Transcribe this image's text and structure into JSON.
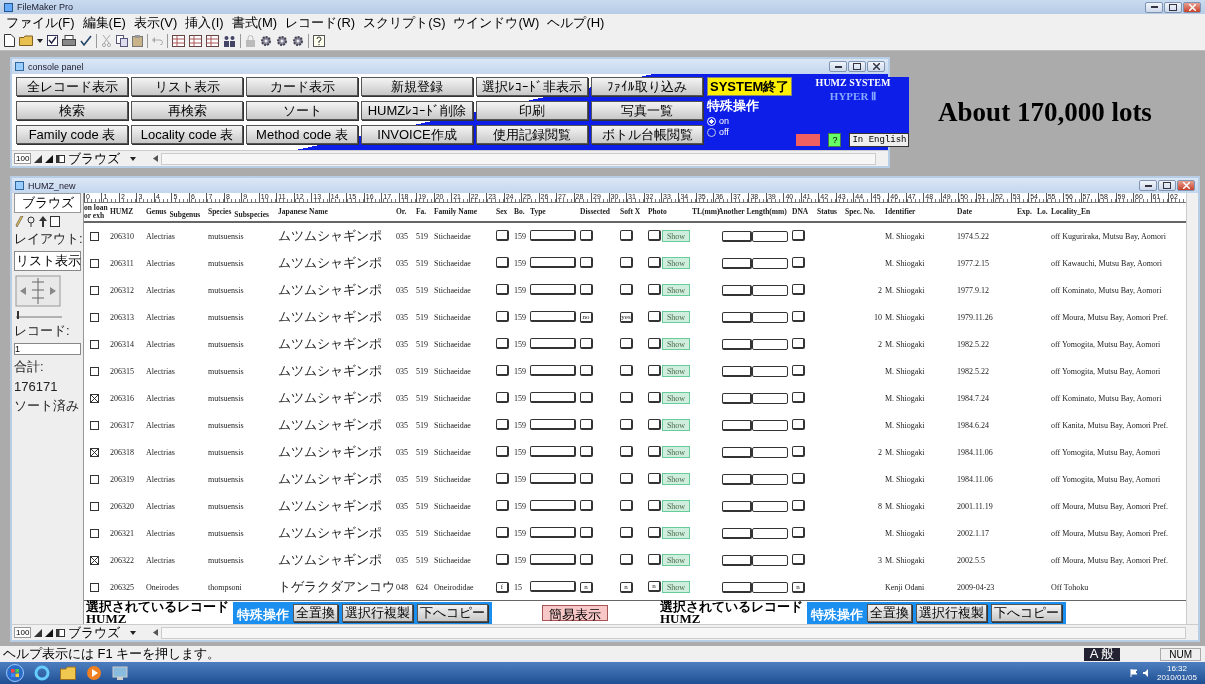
{
  "app": {
    "title": "FileMaker Pro"
  },
  "menu": [
    "ファイル(F)",
    "編集(E)",
    "表示(V)",
    "挿入(I)",
    "書式(M)",
    "レコード(R)",
    "スクリプト(S)",
    "ウインドウ(W)",
    "ヘルプ(H)"
  ],
  "console_panel": {
    "title": "console panel",
    "buttons": [
      "全レコード表示",
      "リスト表示",
      "カード表示",
      "新規登録",
      "選択ﾚｺｰﾄﾞ非表示",
      "ﾌｧｲﾙ取り込み",
      "検索",
      "再検索",
      "ソート",
      "HUMZﾚｺｰﾄﾞ削除",
      "印刷",
      "写真一覧",
      "Family code 表",
      "Locality code 表",
      "Method code 表",
      "INVOICE作成",
      "使用記録閲覧",
      "ボトル台帳閲覧"
    ],
    "system_exit": "SYSTEM終了",
    "special_label": "特殊操作",
    "radios": [
      {
        "label": "on",
        "selected": true
      },
      {
        "label": "off",
        "selected": false
      }
    ],
    "system_name": "HUMZ SYSTEM",
    "system_sub": "HYPER Ⅱ",
    "help_button": "?",
    "english_button": "In English",
    "zoom": "100",
    "mode": "ブラウズ"
  },
  "annotation": "About 170,000 lots",
  "records_window": {
    "title": "HUMZ_new",
    "mode_tab": "ブラウズ",
    "layout_label": "レイアウト:",
    "layout_value": "リスト表示",
    "record_label": "レコード:",
    "record_value": "1",
    "total_label": "合計:",
    "total_value": "176171",
    "sort_state": "ソート済み",
    "ruler": [
      "0",
      "1",
      "2",
      "3",
      "4",
      "5",
      "6",
      "7",
      "8",
      "9",
      "10",
      "11",
      "12",
      "13",
      "14",
      "15",
      "16",
      "17",
      "18",
      "19",
      "20",
      "21",
      "22",
      "23",
      "24",
      "25",
      "26",
      "27",
      "28",
      "29",
      "30",
      "31",
      "32",
      "33",
      "34",
      "35",
      "36",
      "37",
      "38",
      "39",
      "40",
      "41",
      "42",
      "43",
      "44",
      "45",
      "46",
      "47",
      "48",
      "49",
      "50",
      "51",
      "52",
      "53",
      "54",
      "55",
      "56",
      "57",
      "58",
      "59",
      "60",
      "61",
      "62"
    ],
    "columns": [
      {
        "label": "on loan or exh"
      },
      {
        "label": "HUMZ"
      },
      {
        "label": "Genus",
        "sub": "Subgenus"
      },
      {
        "label": "Species",
        "sub": "Subspecies"
      },
      {
        "label": "Japanese Name"
      },
      {
        "label": "Or."
      },
      {
        "label": "Fa."
      },
      {
        "label": "Family Name"
      },
      {
        "label": "Sex"
      },
      {
        "label": "Bo."
      },
      {
        "label": "Type"
      },
      {
        "label": "Dissected"
      },
      {
        "label": "Soft X"
      },
      {
        "label": "Photo"
      },
      {
        "label": "TL(mm)"
      },
      {
        "label": "Another Length(mm)"
      },
      {
        "label": "DNA"
      },
      {
        "label": "Status"
      },
      {
        "label": "Spec. No."
      },
      {
        "label": "Identifier"
      },
      {
        "label": "Date"
      },
      {
        "label": "Exp."
      },
      {
        "label": "Lo."
      },
      {
        "label": "Locality_En"
      }
    ],
    "rows": [
      {
        "on_loan": false,
        "humz": "206310",
        "genus": "Alectrias",
        "species": "mutsuensis",
        "japanese": "ムツムシャギンポ",
        "order": "035",
        "family_code": "519",
        "family": "Stichaeidae",
        "bo": "159",
        "photo_button": "Show",
        "identifier": "M. Shiogaki",
        "date": "1974.5.22",
        "locality": "off Kuguriraka, Mutsu Bay, Aomori"
      },
      {
        "on_loan": false,
        "humz": "206311",
        "genus": "Alectrias",
        "species": "mutsuensis",
        "japanese": "ムツムシャギンポ",
        "order": "035",
        "family_code": "519",
        "family": "Stichaeidae",
        "bo": "159",
        "photo_button": "Show",
        "identifier": "M. Shiogaki",
        "date": "1977.2.15",
        "locality": "off Kawauchi, Mutsu Bay, Aomori"
      },
      {
        "on_loan": false,
        "humz": "206312",
        "genus": "Alectrias",
        "species": "mutsuensis",
        "japanese": "ムツムシャギンポ",
        "order": "035",
        "family_code": "519",
        "family": "Stichaeidae",
        "bo": "159",
        "photo_button": "Show",
        "spec_no": "2",
        "identifier": "M. Shiogaki",
        "date": "1977.9.12",
        "locality": "off Kominato, Mutsu Bay, Aomori"
      },
      {
        "on_loan": false,
        "humz": "206313",
        "genus": "Alectrias",
        "species": "mutsuensis",
        "japanese": "ムツムシャギンポ",
        "order": "035",
        "family_code": "519",
        "family": "Stichaeidae",
        "bo": "159",
        "dissected": "no",
        "soft_x": "yes",
        "photo_button": "Show",
        "spec_no": "10",
        "identifier": "M. Shiogaki",
        "date": "1979.11.26",
        "locality": "off Moura, Mutsu Bay, Aomori Pref."
      },
      {
        "on_loan": false,
        "humz": "206314",
        "genus": "Alectrias",
        "species": "mutsuensis",
        "japanese": "ムツムシャギンポ",
        "order": "035",
        "family_code": "519",
        "family": "Stichaeidae",
        "bo": "159",
        "photo_button": "Show",
        "spec_no": "2",
        "identifier": "M. Shiogaki",
        "date": "1982.5.22",
        "locality": "off Yomogita, Mutsu Bay, Aomori"
      },
      {
        "on_loan": false,
        "humz": "206315",
        "genus": "Alectrias",
        "species": "mutsuensis",
        "japanese": "ムツムシャギンポ",
        "order": "035",
        "family_code": "519",
        "family": "Stichaeidae",
        "bo": "159",
        "photo_button": "Show",
        "identifier": "M. Shiogaki",
        "date": "1982.5.22",
        "locality": "off Yomogita, Mutsu Bay, Aomori"
      },
      {
        "on_loan": true,
        "humz": "206316",
        "genus": "Alectrias",
        "species": "mutsuensis",
        "japanese": "ムツムシャギンポ",
        "order": "035",
        "family_code": "519",
        "family": "Stichaeidae",
        "bo": "159",
        "photo_button": "Show",
        "identifier": "M. Shiogaki",
        "date": "1984.7.24",
        "locality": "off Kominato, Mutsu Bay, Aomori"
      },
      {
        "on_loan": false,
        "humz": "206317",
        "genus": "Alectrias",
        "species": "mutsuensis",
        "japanese": "ムツムシャギンポ",
        "order": "035",
        "family_code": "519",
        "family": "Stichaeidae",
        "bo": "159",
        "photo_button": "Show",
        "identifier": "M. Shiogaki",
        "date": "1984.6.24",
        "locality": "off Kanita, Mutsu Bay, Aomori Pref."
      },
      {
        "on_loan": true,
        "humz": "206318",
        "genus": "Alectrias",
        "species": "mutsuensis",
        "japanese": "ムツムシャギンポ",
        "order": "035",
        "family_code": "519",
        "family": "Stichaeidae",
        "bo": "159",
        "photo_button": "Show",
        "spec_no": "2",
        "identifier": "M. Shiogaki",
        "date": "1984.11.06",
        "locality": "off Yomogita, Mutsu Bay, Aomori"
      },
      {
        "on_loan": false,
        "humz": "206319",
        "genus": "Alectrias",
        "species": "mutsuensis",
        "japanese": "ムツムシャギンポ",
        "order": "035",
        "family_code": "519",
        "family": "Stichaeidae",
        "bo": "159",
        "photo_button": "Show",
        "identifier": "M. Shiogaki",
        "date": "1984.11.06",
        "locality": "off Yomogita, Mutsu Bay, Aomori"
      },
      {
        "on_loan": false,
        "humz": "206320",
        "genus": "Alectrias",
        "species": "mutsuensis",
        "japanese": "ムツムシャギンポ",
        "order": "035",
        "family_code": "519",
        "family": "Stichaeidae",
        "bo": "159",
        "photo_button": "Show",
        "spec_no": "8",
        "identifier": "M. Shiogaki",
        "date": "2001.11.19",
        "locality": "off Moura, Mutsu Bay, Aomori Pref."
      },
      {
        "on_loan": false,
        "humz": "206321",
        "genus": "Alectrias",
        "species": "mutsuensis",
        "japanese": "ムツムシャギンポ",
        "order": "035",
        "family_code": "519",
        "family": "Stichaeidae",
        "bo": "159",
        "photo_button": "Show",
        "identifier": "M. Shiogaki",
        "date": "2002.1.17",
        "locality": "off Moura, Mutsu Bay, Aomori Pref."
      },
      {
        "on_loan": true,
        "humz": "206322",
        "genus": "Alectrias",
        "species": "mutsuensis",
        "japanese": "ムツムシャギンポ",
        "order": "035",
        "family_code": "519",
        "family": "Stichaeidae",
        "bo": "159",
        "photo_button": "Show",
        "spec_no": "3",
        "identifier": "M. Shiogaki",
        "date": "2002.5.5",
        "locality": "off Moura, Mutsu Bay, Aomori Pref."
      },
      {
        "on_loan": false,
        "humz": "206325",
        "genus": "Oneirodes",
        "species": "thompsoni",
        "japanese": "トゲラクダアンコウ",
        "order": "048",
        "family_code": "624",
        "family": "Oneirodidae",
        "sex": "f",
        "bo": "15",
        "dissected": "n",
        "soft_x": "n",
        "photo": "n",
        "photo_button": "Show",
        "dna": "n",
        "identifier": "Kenji Odani",
        "date": "2009-04-23",
        "locality": "Off Tohoku"
      }
    ],
    "footer": {
      "groups": [
        {
          "caption": "選択されているレコード",
          "table": "HUMZ",
          "panel_label": "特殊操作",
          "buttons": [
            "全置換",
            "選択行複製",
            "下へコピー"
          ]
        },
        {
          "caption": "選択されているレコード",
          "table": "HUMZ",
          "panel_label": "特殊操作",
          "buttons": [
            "全置換",
            "選択行複製",
            "下へコピー"
          ]
        }
      ],
      "simple_view_button": "簡易表示"
    },
    "zoom": "100",
    "mode": "ブラウズ"
  },
  "status_bar": {
    "text": "ヘルプ表示には F1 キーを押します。",
    "language_bar": "A 般",
    "indicator": "NUM"
  },
  "taskbar": {
    "time": "16:32",
    "date": "2010/01/05"
  }
}
